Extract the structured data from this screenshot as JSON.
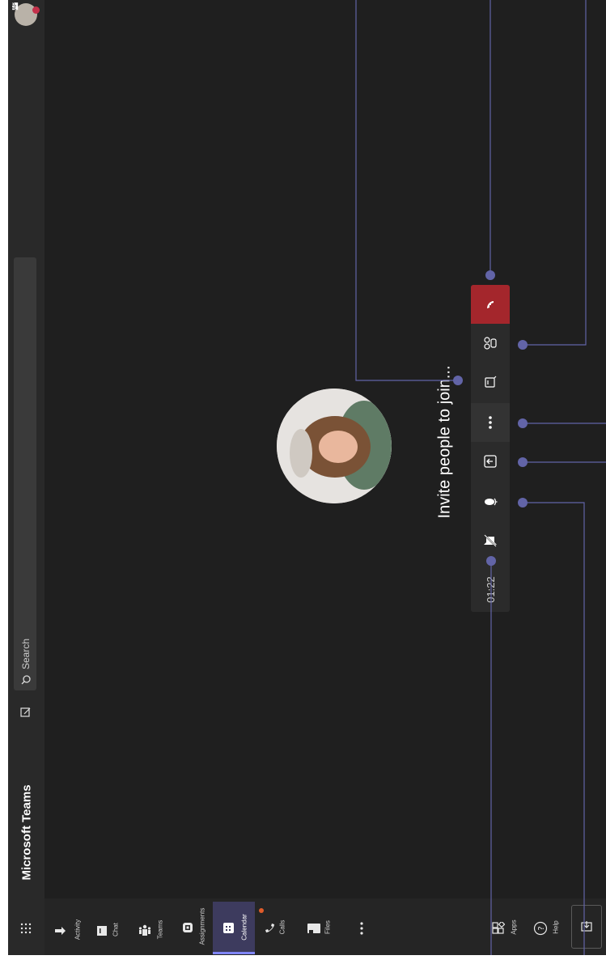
{
  "app": {
    "title": "Microsoft Teams"
  },
  "search": {
    "placeholder": "Search"
  },
  "profile": {
    "initials": "AP",
    "status_color": "#c4314b"
  },
  "nav": {
    "items": [
      {
        "label": "Activity",
        "icon": "bell-icon"
      },
      {
        "label": "Chat",
        "icon": "chat-icon"
      },
      {
        "label": "Teams",
        "icon": "teams-icon"
      },
      {
        "label": "Assignments",
        "icon": "assignments-icon"
      },
      {
        "label": "Calendar",
        "icon": "calendar-icon",
        "active": true
      },
      {
        "label": "Calls",
        "icon": "phone-icon"
      },
      {
        "label": "Files",
        "icon": "files-icon"
      }
    ],
    "apps_label": "Apps",
    "help_label": "Help"
  },
  "meeting": {
    "invite_text": "Invite people to join...",
    "timer": "01:22"
  },
  "colors": {
    "accent": "#6264a7",
    "hangup": "#a4262c",
    "background": "#1f1f1f"
  }
}
